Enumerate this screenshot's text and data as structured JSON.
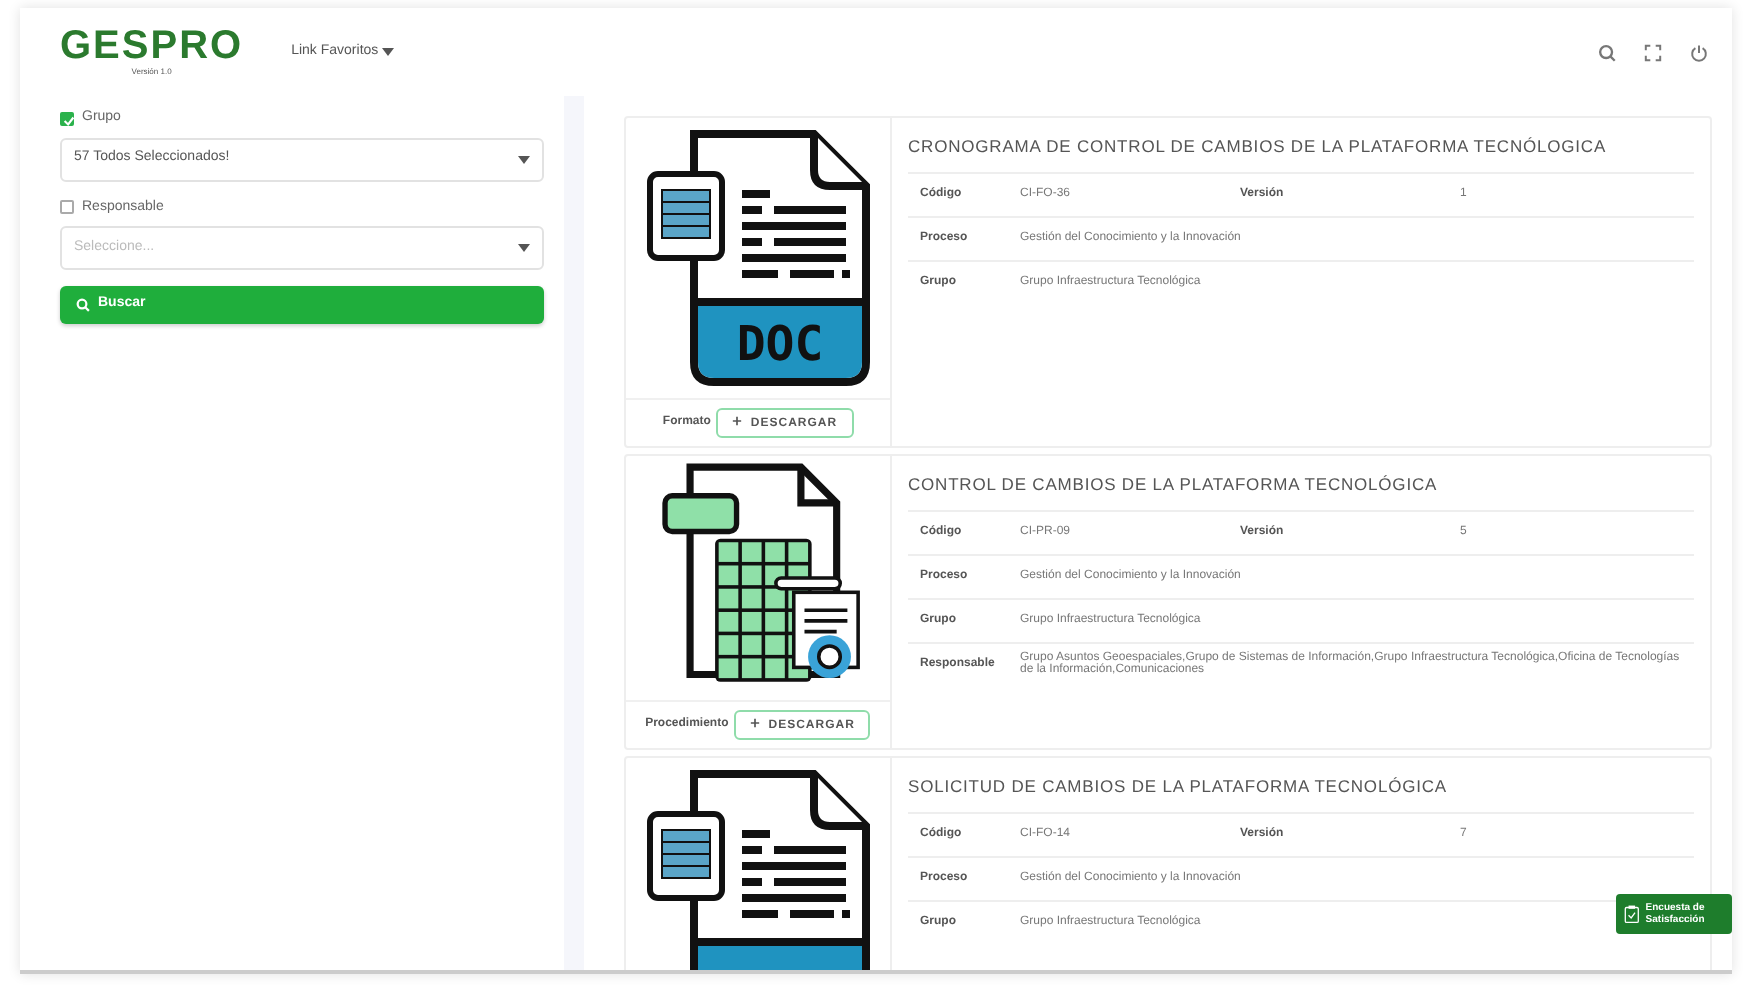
{
  "header": {
    "logo": "GESPRO",
    "version": "Versión 1.0",
    "menu": "Link Favoritos"
  },
  "filters": [
    {
      "label": "Grupo",
      "checked": true,
      "value": "57 Todos Seleccionados!"
    },
    {
      "label": "Responsable",
      "checked": false,
      "placeholder": "Seleccione..."
    }
  ],
  "search_button": "Buscar",
  "documents": [
    {
      "kind": "doc",
      "icon_label": "DOC",
      "title": "CRONOGRAMA DE CONTROL DE CAMBIOS DE LA PLATAFORMA TECNÓLOGICA",
      "rows": [
        [
          {
            "label": "Código",
            "value": "CI-FO-36"
          },
          {
            "label": "Versión",
            "value": "1"
          }
        ],
        [
          {
            "label": "Proceso",
            "value": "Gestión del Conocimiento y la Innovación"
          }
        ],
        [
          {
            "label": "Grupo",
            "value": "Grupo Infraestructura Tecnológica"
          }
        ]
      ],
      "footer_label": "Formato",
      "button": "DESCARGAR"
    },
    {
      "kind": "spreadsheet",
      "title": "CONTROL DE CAMBIOS DE LA PLATAFORMA TECNOLÓGICA",
      "rows": [
        [
          {
            "label": "Código",
            "value": "CI-PR-09"
          },
          {
            "label": "Versión",
            "value": "5"
          }
        ],
        [
          {
            "label": "Proceso",
            "value": "Gestión del Conocimiento y la Innovación"
          }
        ],
        [
          {
            "label": "Grupo",
            "value": "Grupo Infraestructura Tecnológica"
          }
        ],
        [
          {
            "label": "Responsable",
            "value": "Grupo Asuntos Geoespaciales,Grupo de Sistemas de Información,Grupo Infraestructura Tecnológica,Oficina de Tecnologías de la Información,Comunicaciones"
          }
        ]
      ],
      "footer_label": "Procedimiento",
      "button": "DESCARGAR"
    },
    {
      "kind": "doc",
      "title": "SOLICITUD DE CAMBIOS DE LA PLATAFORMA TECNOLÓGICA",
      "rows": [
        [
          {
            "label": "Código",
            "value": "CI-FO-14"
          },
          {
            "label": "Versión",
            "value": "7"
          }
        ],
        [
          {
            "label": "Proceso",
            "value": "Gestión del Conocimiento y la Innovación"
          }
        ],
        [
          {
            "label": "Grupo",
            "value": "Grupo Infraestructura Tecnológica"
          }
        ]
      ]
    }
  ],
  "survey_button": "Encuesta de Satisfacción"
}
